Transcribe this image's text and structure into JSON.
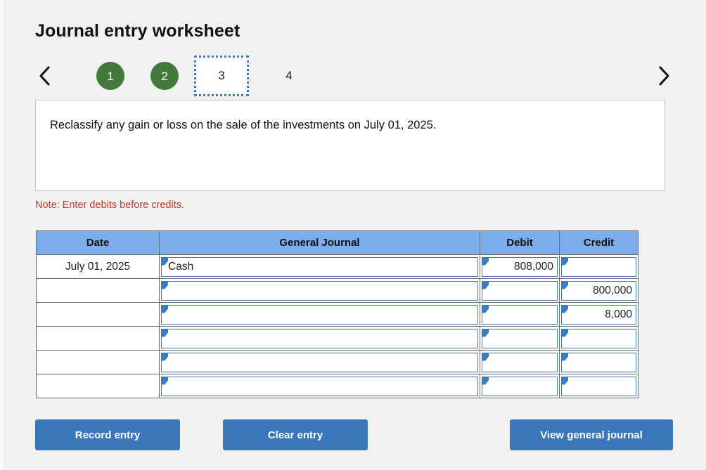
{
  "page": {
    "title": "Journal entry worksheet",
    "instruction": "Reclassify any gain or loss on the sale of the investments on July 01, 2025.",
    "note": "Note: Enter debits before credits."
  },
  "pager": {
    "prev_icon": "chevron-left-icon",
    "next_icon": "chevron-right-icon",
    "steps": [
      {
        "label": "1",
        "state": "completed"
      },
      {
        "label": "2",
        "state": "completed"
      },
      {
        "label": "3",
        "state": "current"
      },
      {
        "label": "4",
        "state": "upcoming"
      }
    ],
    "completed_color": "#44793c",
    "current_border_color": "#3b7cc0"
  },
  "table": {
    "headers": [
      "Date",
      "General Journal",
      "Debit",
      "Credit"
    ],
    "header_bg": "#7badea",
    "rows": [
      {
        "date": "July 01, 2025",
        "account": "Cash",
        "debit": "808,000",
        "credit": ""
      },
      {
        "date": "",
        "account": "",
        "debit": "",
        "credit": "800,000"
      },
      {
        "date": "",
        "account": "",
        "debit": "",
        "credit": "8,000"
      },
      {
        "date": "",
        "account": "",
        "debit": "",
        "credit": ""
      },
      {
        "date": "",
        "account": "",
        "debit": "",
        "credit": ""
      },
      {
        "date": "",
        "account": "",
        "debit": "",
        "credit": ""
      }
    ]
  },
  "buttons": {
    "record": "Record entry",
    "clear": "Clear entry",
    "view": "View general journal",
    "color": "#3a76b8"
  }
}
